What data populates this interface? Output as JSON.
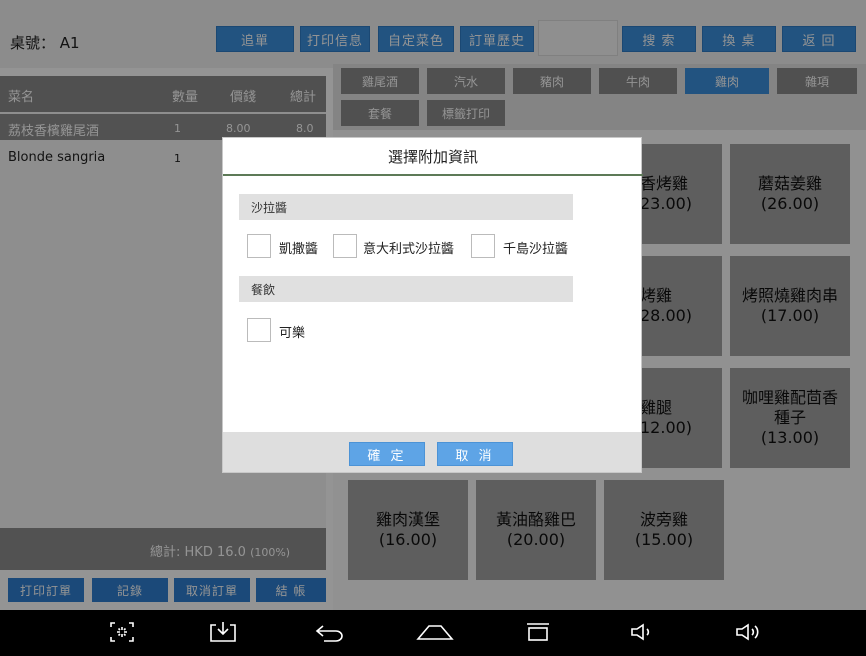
{
  "header": {
    "table_label": "桌號：",
    "table_value": "A1",
    "buttons": [
      "追單",
      "打印信息",
      "自定菜色",
      "訂單歷史",
      "搜 索",
      "換 桌",
      "返 回"
    ]
  },
  "order_panel": {
    "columns": [
      "菜名",
      "數量",
      "價錢",
      "總計"
    ],
    "rows": [
      {
        "name": "荔枝香檳雞尾酒",
        "qty": "1",
        "price": "8.00",
        "total": "8.0"
      },
      {
        "name": "Blonde sangria",
        "qty": "1",
        "price": "",
        "total": ""
      }
    ],
    "total_label": "總計:",
    "total_value": "HKD 16.0",
    "total_percent": "(100%)",
    "actions": [
      "打印訂單",
      "記錄",
      "取消訂單",
      "結 帳"
    ]
  },
  "categories": [
    "雞尾酒",
    "汽水",
    "豬肉",
    "牛肉",
    "雞肉",
    "雜項",
    "套餐",
    "標籤打印"
  ],
  "active_category": "雞肉",
  "dishes": [
    {
      "name": "香烤雞",
      "price": "23.00)"
    },
    {
      "name": "蘑菇姜雞",
      "price": "(26.00)"
    },
    {
      "name": "烤雞",
      "price": "28.00)"
    },
    {
      "name": "烤照燒雞肉串",
      "price": "(17.00)"
    },
    {
      "name": "雞腿",
      "price": "12.00)"
    },
    {
      "name": "咖哩雞配茴香",
      "name2": "種子",
      "price": "(13.00)"
    },
    {
      "name": "雞肉漢堡",
      "price": "(16.00)"
    },
    {
      "name": "黃油酪雞巴",
      "price": "(20.00)"
    },
    {
      "name": "波旁雞",
      "price": "(15.00)"
    }
  ],
  "modal": {
    "title": "選擇附加資訊",
    "sections": [
      {
        "heading": "沙拉醬",
        "options": [
          "凱撒醬",
          "意大利式沙拉醬",
          "千島沙拉醬"
        ]
      },
      {
        "heading": "餐飲",
        "options": [
          "可樂"
        ]
      }
    ],
    "confirm_label": "確 定",
    "cancel_label": "取 消"
  },
  "colors": {
    "accent_blue": "#3b8fdc",
    "tile_gray": "#a3a3a3",
    "modal_title_rule": "#5d7a57"
  },
  "navbar_icons": [
    "screenshot-icon",
    "download-icon",
    "back-icon",
    "home-icon",
    "recents-icon",
    "volume-down-icon",
    "volume-up-icon"
  ]
}
